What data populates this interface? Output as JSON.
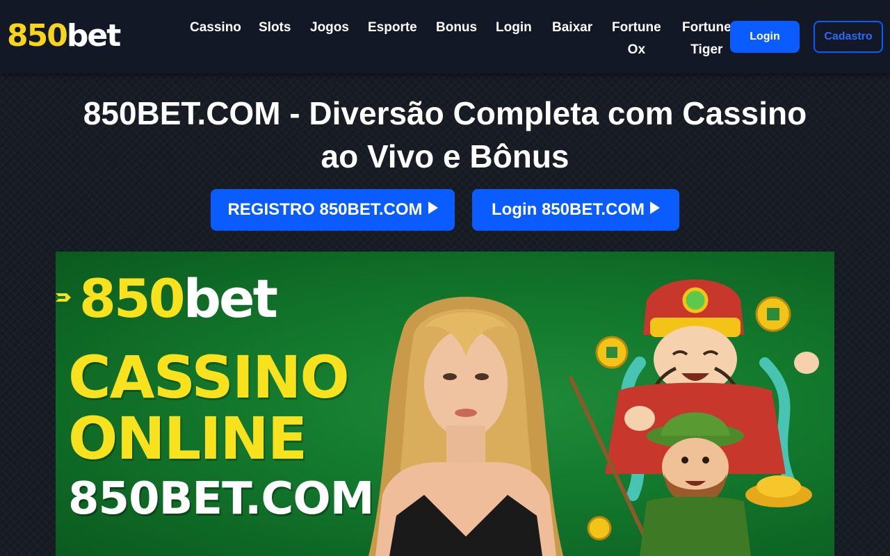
{
  "header": {
    "logo": {
      "num": "850",
      "word": "bet"
    },
    "nav": [
      {
        "label": "Cassino"
      },
      {
        "label": "Slots"
      },
      {
        "label": "Jogos"
      },
      {
        "label": "Esporte"
      },
      {
        "label": "Bonus"
      },
      {
        "label": "Login"
      },
      {
        "label": "Baixar"
      },
      {
        "label_line1": "Fortune",
        "label_line2": "Ox"
      },
      {
        "label_line1": "Fortune",
        "label_line2": "Tiger"
      }
    ],
    "login_label": "Login",
    "cadastro_label": "Cadastro"
  },
  "hero": {
    "title_line1": "850BET.COM - Diversão Completa com Cassino",
    "title_line2": "ao Vivo e Bônus",
    "cta_register": "REGISTRO 850BET.COM",
    "cta_login": "Login 850BET.COM"
  },
  "banner": {
    "logo": {
      "num": "850",
      "word": "bet"
    },
    "line1": "CASSINO",
    "line2": "ONLINE",
    "domain": "850BET.COM"
  },
  "colors": {
    "accent_blue": "#0a5cff",
    "brand_yellow": "#f7d51d",
    "header_bg": "#121826",
    "banner_green": "#137a2d"
  },
  "icons": [
    "play-arrow-icon",
    "banner-arrow-icon"
  ]
}
